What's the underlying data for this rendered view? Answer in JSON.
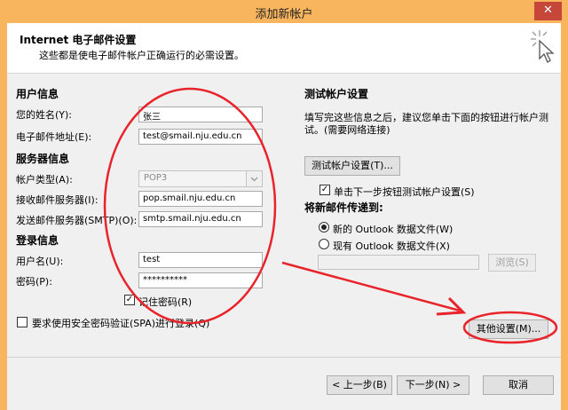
{
  "window": {
    "title": "添加新帐户",
    "close_glyph": "✕"
  },
  "header": {
    "title": "Internet 电子邮件设置",
    "subtitle": "这些都是使电子邮件帐户正确运行的必需设置。"
  },
  "user_info": {
    "section": "用户信息",
    "name_label": "您的姓名(Y):",
    "name_value": "张三",
    "email_label": "电子邮件地址(E):",
    "email_value": "test@smail.nju.edu.cn"
  },
  "server_info": {
    "section": "服务器信息",
    "type_label": "帐户类型(A):",
    "type_value": "POP3",
    "incoming_label": "接收邮件服务器(I):",
    "incoming_value": "pop.smail.nju.edu.cn",
    "outgoing_label": "发送邮件服务器(SMTP)(O):",
    "outgoing_value": "smtp.smail.nju.edu.cn"
  },
  "login_info": {
    "section": "登录信息",
    "username_label": "用户名(U):",
    "username_value": "test",
    "password_label": "密码(P):",
    "password_value": "**********",
    "remember_label": "记住密码(R)",
    "spa_label": "要求使用安全密码验证(SPA)进行登录(Q)"
  },
  "test_settings": {
    "section": "测试帐户设置",
    "description": "填写完这些信息之后，建议您单击下面的按钮进行帐户测试。(需要网络连接)",
    "test_button": "测试帐户设置(T)...",
    "auto_test_label": "单击下一步按钮测试帐户设置(S)"
  },
  "deliver": {
    "section": "将新邮件传递到:",
    "option_new": "新的 Outlook 数据文件(W)",
    "option_existing": "现有 Outlook 数据文件(X)",
    "browse_button": "浏览(S)",
    "selected": "new"
  },
  "buttons": {
    "more_settings": "其他设置(M)...",
    "back": "< 上一步(B)",
    "next": "下一步(N) >",
    "cancel": "取消"
  },
  "colors": {
    "title_bar": "#f9b55e",
    "annotation": "#e8232a"
  }
}
